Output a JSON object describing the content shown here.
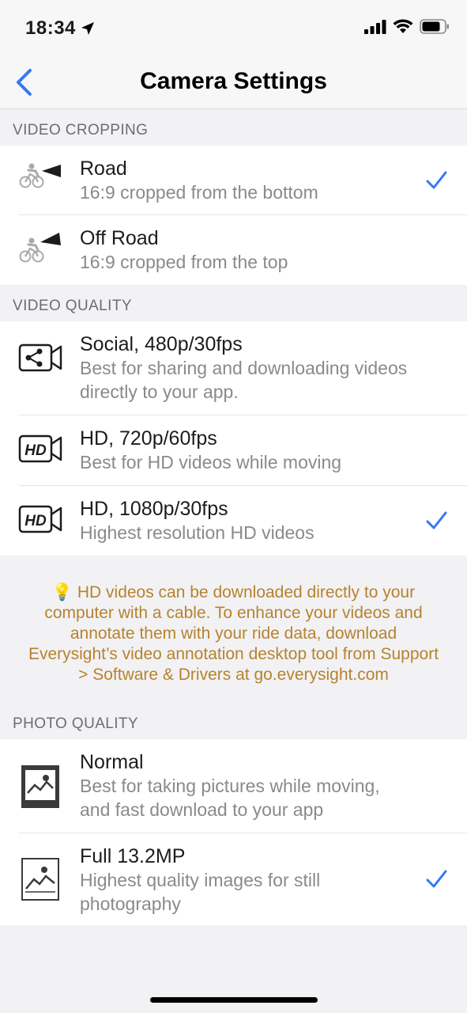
{
  "status": {
    "time": "18:34"
  },
  "nav": {
    "title": "Camera Settings",
    "back_icon": "chevron-left-icon"
  },
  "accent_color": "#3478f6",
  "note_color": "#b7822e",
  "sections": {
    "video_cropping": {
      "header": "VIDEO CROPPING",
      "items": [
        {
          "title": "Road",
          "subtitle": "16:9 cropped from the bottom",
          "icon": "cyclist-camera-icon",
          "selected": true
        },
        {
          "title": "Off Road",
          "subtitle": "16:9 cropped from the top",
          "icon": "cyclist-camera-up-icon",
          "selected": false
        }
      ]
    },
    "video_quality": {
      "header": "VIDEO QUALITY",
      "items": [
        {
          "title": "Social, 480p/30fps",
          "subtitle": "Best for sharing and downloading videos directly to your app.",
          "icon": "share-video-icon",
          "selected": false
        },
        {
          "title": "HD, 720p/60fps",
          "subtitle": "Best for HD videos while moving",
          "icon": "hd-video-icon",
          "selected": false,
          "badge": "HD"
        },
        {
          "title": "HD, 1080p/30fps",
          "subtitle": "Highest resolution HD videos",
          "icon": "hd-video-icon",
          "selected": true,
          "badge": "HD"
        }
      ],
      "note": "💡 HD videos can be downloaded directly to your computer with a cable. To enhance your videos and annotate them with your ride data, download Everysight’s video annotation desktop tool from Support > Software & Drivers at go.everysight.com"
    },
    "photo_quality": {
      "header": "PHOTO QUALITY",
      "items": [
        {
          "title": "Normal",
          "subtitle": "Best for taking pictures while moving, and fast download to your app",
          "icon": "photo-filled-icon",
          "selected": false
        },
        {
          "title": "Full 13.2MP",
          "subtitle": "Highest quality images for still photography",
          "icon": "photo-outline-icon",
          "selected": true
        }
      ]
    }
  }
}
